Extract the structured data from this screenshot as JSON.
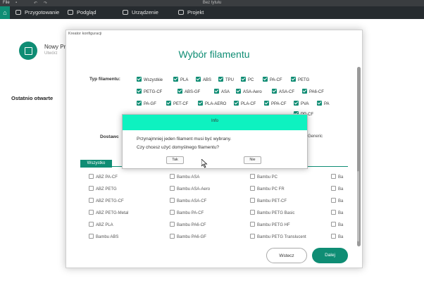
{
  "titlebar": {
    "file_label": "File",
    "title": "Bez tytułu"
  },
  "nav": {
    "tabs": [
      {
        "label": "Przygotowanie"
      },
      {
        "label": "Podgląd"
      },
      {
        "label": "Urządzenie"
      },
      {
        "label": "Projekt"
      }
    ]
  },
  "home": {
    "new_project": "Nowy Pr",
    "new_project_sub": "Utwórz",
    "recent": "Ostatnio otwarte"
  },
  "wizard": {
    "window_title": "Kreator konfiguracji",
    "heading": "Wybór filamentu",
    "type_label": "Typ filamentu:",
    "vendor_label": "Dostawc",
    "generic_label": "Generic",
    "types": [
      {
        "label": "Wszystkie",
        "checked": true
      },
      {
        "label": "PLA",
        "checked": true
      },
      {
        "label": "ABS",
        "checked": true
      },
      {
        "label": "TPU",
        "checked": true
      },
      {
        "label": "PC",
        "checked": true
      },
      {
        "label": "PA-CF",
        "checked": true
      },
      {
        "label": "PETG",
        "checked": true
      },
      {
        "label": "PETG-CF",
        "checked": true
      },
      {
        "label": "ABS-GF",
        "checked": true
      },
      {
        "label": "ASA",
        "checked": true
      },
      {
        "label": "ASA-Aero",
        "checked": true
      },
      {
        "label": "ASA-CF",
        "checked": true
      },
      {
        "label": "PA6-CF",
        "checked": true
      },
      {
        "label": "PA-GF",
        "checked": true
      },
      {
        "label": "PET-CF",
        "checked": true
      },
      {
        "label": "PLA-AERO",
        "checked": true
      },
      {
        "label": "PLA-CF",
        "checked": true
      },
      {
        "label": "PPA-CF",
        "checked": true
      },
      {
        "label": "PVA",
        "checked": true
      },
      {
        "label": "PA",
        "checked": true
      },
      {
        "label": "PP-CF",
        "checked": true
      }
    ],
    "tab_all": "Wszystko",
    "filaments": [
      [
        "ABZ PA-CF",
        "Bambu ASA",
        "Bambu PC",
        "Ba"
      ],
      [
        "ABZ PETG",
        "Bambu ASA-Aero",
        "Bambu PC FR",
        "Ba"
      ],
      [
        "ABZ PETG-CF",
        "Bambu ASA-CF",
        "Bambu PET-CF",
        "Ba"
      ],
      [
        "ABZ PETG-Metal",
        "Bambu PA-CF",
        "Bambu PETG Basic",
        "Ba"
      ],
      [
        "ABZ PLA",
        "Bambu PA6-CF",
        "Bambu PETG HF",
        "Ba"
      ],
      [
        "Bambu ABS",
        "Bambu PA6-GF",
        "Bambu PETG Translucent",
        "Ba"
      ]
    ],
    "back_label": "Wstecz",
    "next_label": "Dalej"
  },
  "modal": {
    "title": "Info",
    "message_line1": "Przynajmniej jeden filament musi być wybrany.",
    "message_line2": "Czy chcesz użyć domyślnego filamentu?",
    "yes_label": "Tak",
    "no_label": "Nie"
  },
  "colors": {
    "accent": "#0f8d74",
    "modal_header": "#0ef2c0",
    "nav_bg": "#262b2f"
  }
}
